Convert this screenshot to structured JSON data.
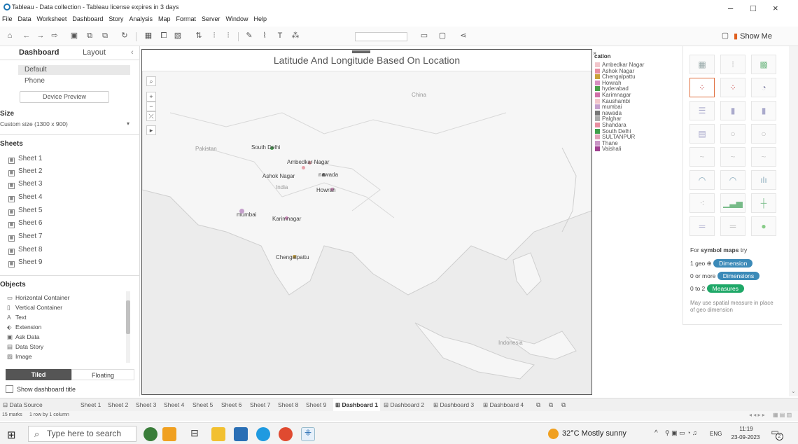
{
  "window": {
    "title": "Tableau - Data collection - Tableau license expires in 3 days",
    "minimize": "–",
    "maximize": "□",
    "close": "×"
  },
  "menu": [
    "File",
    "Data",
    "Worksheet",
    "Dashboard",
    "Story",
    "Analysis",
    "Map",
    "Format",
    "Server",
    "Window",
    "Help"
  ],
  "toolbar": {
    "show_me": "Show Me"
  },
  "left_panel": {
    "tab_dashboard": "Dashboard",
    "tab_layout": "Layout",
    "collapse": "‹",
    "device_default": "Default",
    "device_phone": "Phone",
    "device_preview": "Device Preview",
    "size_heading": "Size",
    "size_value": "Custom size (1300 x 900)",
    "sheets_heading": "Sheets",
    "sheets": [
      "Sheet 1",
      "Sheet 2",
      "Sheet 3",
      "Sheet 4",
      "Sheet 5",
      "Sheet 6",
      "Sheet 7",
      "Sheet 8",
      "Sheet 9"
    ],
    "objects_heading": "Objects",
    "objects": [
      {
        "icon": "horizontal-container-icon",
        "glyph": "▭",
        "label": "Horizontal Container"
      },
      {
        "icon": "vertical-container-icon",
        "glyph": "▯",
        "label": "Vertical Container"
      },
      {
        "icon": "text-icon",
        "glyph": "A",
        "label": "Text"
      },
      {
        "icon": "extension-icon",
        "glyph": "⬖",
        "label": "Extension"
      },
      {
        "icon": "ask-data-icon",
        "glyph": "▣",
        "label": "Ask Data"
      },
      {
        "icon": "data-story-icon",
        "glyph": "▤",
        "label": "Data Story"
      },
      {
        "icon": "image-icon",
        "glyph": "▨",
        "label": "Image"
      }
    ],
    "tiled": "Tiled",
    "floating": "Floating",
    "show_title": "Show dashboard title"
  },
  "map": {
    "title": "Latitude And Longitude Based On Location",
    "countries": [
      {
        "name": "China"
      },
      {
        "name": "Pakistan"
      },
      {
        "name": "India"
      },
      {
        "name": "Indonesia"
      }
    ],
    "points": [
      {
        "name": "South Delhi",
        "color": "#3ea04a"
      },
      {
        "name": "Ambedkar Nagar",
        "color": "#e8a0a8"
      },
      {
        "name": "Ashok Nagar",
        "color": "#e8a0a8"
      },
      {
        "name": "nawada",
        "color": "#777777"
      },
      {
        "name": "Howrah",
        "color": "#d88fc2"
      },
      {
        "name": "mumbai",
        "color": "#c5a0cc"
      },
      {
        "name": "Karimnagar",
        "color": "#d88fc2"
      },
      {
        "name": "Chengalpattu",
        "color": "#c9a23a"
      }
    ]
  },
  "legend": {
    "heading": "cation",
    "items": [
      {
        "label": "Ambedkar Nagar",
        "color": "#f2c6cb"
      },
      {
        "label": "Ashok Nagar",
        "color": "#e88ea0"
      },
      {
        "label": "Chengalpattu",
        "color": "#c9a23a"
      },
      {
        "label": "Howrah",
        "color": "#d88fc2"
      },
      {
        "label": "hyderabad",
        "color": "#4aa04a"
      },
      {
        "label": "Karimnagar",
        "color": "#d06fa8"
      },
      {
        "label": "Kaushambi",
        "color": "#f2c6cb"
      },
      {
        "label": "mumbai",
        "color": "#c5a0cc"
      },
      {
        "label": "nawada",
        "color": "#777777"
      },
      {
        "label": "Palghar",
        "color": "#aaaaaa"
      },
      {
        "label": "Shahdara",
        "color": "#e88ea0"
      },
      {
        "label": "South Delhi",
        "color": "#3ea04a"
      },
      {
        "label": "SULTANPUR",
        "color": "#e0a0b8"
      },
      {
        "label": "Thane",
        "color": "#c995c5"
      },
      {
        "label": "Vaishali",
        "color": "#a04090"
      }
    ]
  },
  "show_me": {
    "hint_prefix": "For ",
    "hint_bold": "symbol maps",
    "hint_suffix": " try",
    "geo_label": "1 geo",
    "geo_pill": "Dimension",
    "dims_label": "0 or more",
    "dims_pill": "Dimensions",
    "meas_label": "0 to 2",
    "meas_pill": "Measures",
    "note": "May use spatial measure in place of geo dimension",
    "pill_blue": "#3b8ab8",
    "pill_green": "#1fa868"
  },
  "bottom_tabs": {
    "data_source": "Data Source",
    "tabs": [
      "Sheet 1",
      "Sheet 2",
      "Sheet 3",
      "Sheet 4",
      "Sheet 5",
      "Sheet 6",
      "Sheet 7",
      "Sheet 8",
      "Sheet 9",
      "Dashboard 1",
      "Dashboard 2",
      "Dashboard 3",
      "Dashboard 4"
    ],
    "active": "Dashboard 1"
  },
  "status": {
    "marks": "15 marks",
    "rows": "1 row by 1 column"
  },
  "taskbar": {
    "search_placeholder": "Type here to search",
    "weather": "32°C  Mostly sunny",
    "lang": "ENG",
    "time": "11:19",
    "date": "23-09-2023",
    "notifications": "2"
  }
}
